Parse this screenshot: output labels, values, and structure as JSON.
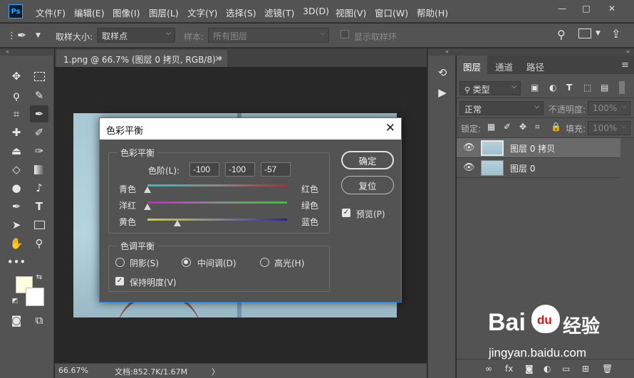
{
  "app": {
    "logo_text": "Ps",
    "menu": [
      "文件(F)",
      "编辑(E)",
      "图像(I)",
      "图层(L)",
      "文字(Y)",
      "选择(S)",
      "滤镜(T)",
      "3D(D)",
      "视图(V)",
      "窗口(W)",
      "帮助(H)"
    ],
    "window_buttons": {
      "minimize": "—",
      "restore": "□",
      "close": "✕"
    }
  },
  "options": {
    "sample_size_label": "取样大小:",
    "sample_size_value": "取样点",
    "sample_label": "样本:",
    "sample_value": "所有图层",
    "show_ring_label": "显示取样环"
  },
  "document": {
    "tab_title": "1.png @ 66.7% (图层 0 拷贝, RGB/8) *",
    "tab_close": "×",
    "zoom": "66.67%",
    "doc_size": "文档:852.7K/1.67M",
    "status_arrow": "〉"
  },
  "layers_panel": {
    "tabs": [
      "图层",
      "通道",
      "路径"
    ],
    "filter_label": "类型",
    "blend_mode": "正常",
    "opacity_label": "不透明度:",
    "opacity_value": "100%",
    "lock_label": "锁定:",
    "fill_label": "填充:",
    "fill_value": "100%",
    "layers": [
      {
        "name": "图层 0 拷贝",
        "selected": true
      },
      {
        "name": "图层 0",
        "selected": false
      }
    ]
  },
  "dialog": {
    "title": "色彩平衡",
    "close": "✕",
    "color_balance_group": "色彩平衡",
    "levels_label": "色阶(L):",
    "levels": [
      "-100",
      "-100",
      "-57"
    ],
    "sliders": [
      {
        "left": "青色",
        "right": "红色",
        "value": -100,
        "gradient": [
          "#1ec8c8",
          "#d21e1e"
        ]
      },
      {
        "left": "洋红",
        "right": "绿色",
        "value": -100,
        "gradient": [
          "#d21ed2",
          "#1ed21e"
        ]
      },
      {
        "left": "黄色",
        "right": "蓝色",
        "value": -57,
        "gradient": [
          "#d2d21e",
          "#1e1ed2"
        ]
      }
    ],
    "slider_range": [
      -100,
      100
    ],
    "tone_balance_group": "色调平衡",
    "tones": [
      {
        "label": "阴影(S)",
        "selected": false
      },
      {
        "label": "中间调(D)",
        "selected": true
      },
      {
        "label": "高光(H)",
        "selected": false
      }
    ],
    "preserve_luminosity": "保持明度(V)",
    "ok": "确定",
    "reset": "复位",
    "preview": "预览(P)"
  },
  "watermark": {
    "brand": "Bai",
    "brand_mid": "du",
    "brand_cn": "经验",
    "url": "jingyan.baidu.com"
  }
}
